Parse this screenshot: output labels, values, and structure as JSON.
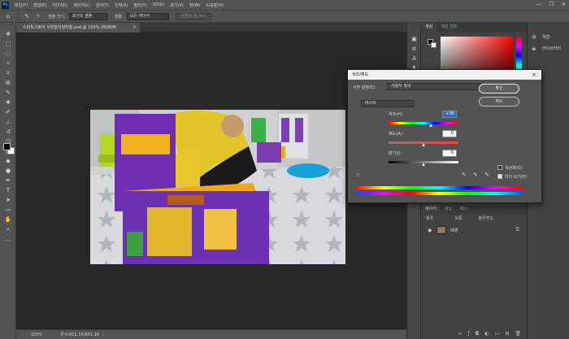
{
  "menubar": {
    "logo": "Ps",
    "items": [
      "파일(F)",
      "편집(E)",
      "이미지(I)",
      "레이어(L)",
      "문자(Y)",
      "선택(S)",
      "필터(T)",
      "3D(D)",
      "보기(V)",
      "창(W)",
      "도움말(H)"
    ],
    "controls": [
      "—",
      "❐",
      "✕"
    ]
  },
  "options": {
    "sample_size_label": "샘플 크기:",
    "sample_size_value": "포인트 샘플",
    "sample_label": "샘플:",
    "sample_value": "모든 레이어",
    "show_ring_label": "샘플링 링 표시"
  },
  "document": {
    "tab_title": "스마트스토어 사장놀이장터칩.psd @ 100% (RGB/8)",
    "close": "×"
  },
  "status": {
    "zoom": "100%",
    "doc_info": "문서:801.1K/801.1K",
    "arrow": "›"
  },
  "right_panel": {
    "tabs": [
      "색상",
      "색상 견본"
    ],
    "layers_tabs": [
      "레이어",
      "채널",
      "패스"
    ],
    "kind_label": "종류",
    "mode_label": "보통",
    "opacity_label": "불투명도",
    "layer_name": "배경"
  },
  "far_right": {
    "items": [
      {
        "icon": "◍",
        "label": "학습"
      },
      {
        "icon": "◒",
        "label": "라이브러리"
      }
    ]
  },
  "dialog": {
    "title": "색조/채도",
    "preset_label": "사전 설정(E):",
    "preset_value": "사용자 정의",
    "channel_value": "마스터",
    "hue_label": "색조(H):",
    "hue_value": "+38",
    "saturation_label": "채도(A):",
    "saturation_value": "0",
    "lightness_label": "밝기(I):",
    "lightness_value": "0",
    "ok_label": "확인",
    "cancel_label": "취소",
    "colorize_label": "색상화(O)",
    "preview_label": "미리 보기(P)",
    "colorize_checked": false,
    "preview_checked": true,
    "hue_thumb": 0.6,
    "saturation_thumb": 0.5,
    "lightness_thumb": 0.5
  }
}
